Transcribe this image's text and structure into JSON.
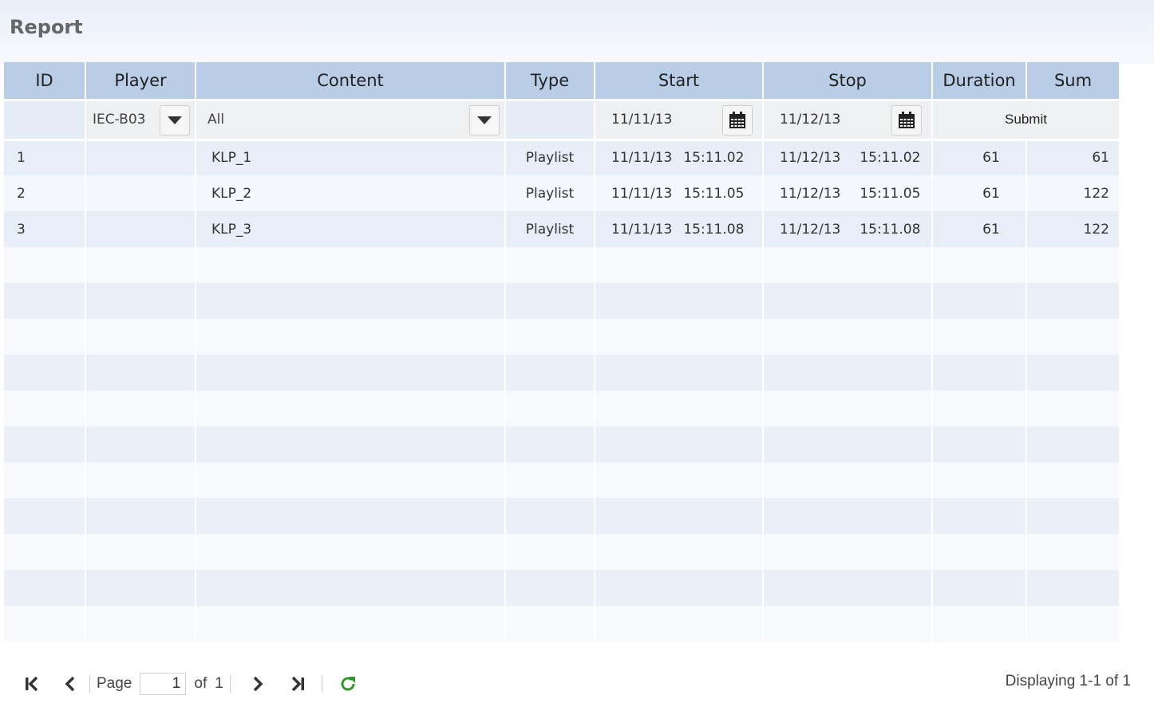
{
  "title": "Report",
  "columns": [
    "ID",
    "Player",
    "Content",
    "Type",
    "Start",
    "Stop",
    "Duration",
    "Sum"
  ],
  "filters": {
    "player_value": "IEC-B03",
    "content_value": "All",
    "start_date": "11/11/13",
    "stop_date": "11/12/13",
    "submit_label": "Submit"
  },
  "rows": [
    {
      "id": "1",
      "player": "",
      "content": "KLP_1",
      "type": "Playlist",
      "start_date": "11/11/13",
      "start_time": "15:11.02",
      "stop_date": "11/12/13",
      "stop_time": "15:11.02",
      "duration": "61",
      "sum": "61"
    },
    {
      "id": "2",
      "player": "",
      "content": "KLP_2",
      "type": "Playlist",
      "start_date": "11/11/13",
      "start_time": "15:11.05",
      "stop_date": "11/12/13",
      "stop_time": "15:11.05",
      "duration": "61",
      "sum": "122"
    },
    {
      "id": "3",
      "player": "",
      "content": "KLP_3",
      "type": "Playlist",
      "start_date": "11/11/13",
      "start_time": "15:11.08",
      "stop_date": "11/12/13",
      "stop_time": "15:11.08",
      "duration": "61",
      "sum": "122"
    }
  ],
  "empty_row_count": 11,
  "pager": {
    "page_label": "Page",
    "page_value": "1",
    "of_label": "of",
    "total_pages": "1",
    "display_info": "Displaying 1-1 of 1"
  },
  "colors": {
    "header_bg": "#b9cde6",
    "refresh_icon": "#2e9a2e"
  },
  "icons": [
    "chevron-down-icon",
    "calendar-icon",
    "first-page-icon",
    "prev-page-icon",
    "next-page-icon",
    "last-page-icon",
    "refresh-icon"
  ]
}
